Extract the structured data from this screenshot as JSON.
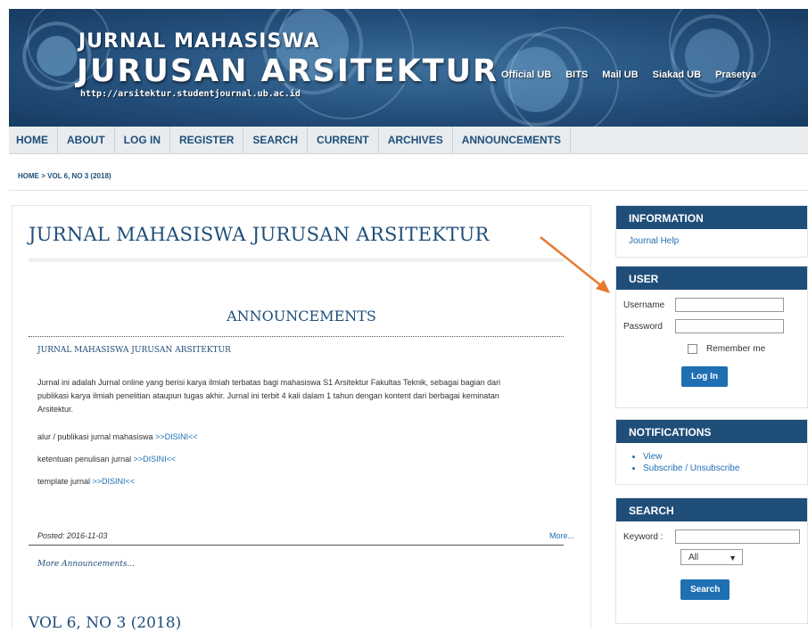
{
  "header": {
    "logo_line1": "JURNAL MAHASISWA",
    "logo_line2": "JURUSAN ARSITEKTUR",
    "logo_url": "http://arsitektur.studentjournal.ub.ac.id",
    "ext_links": [
      "Official UB",
      "BITS",
      "Mail UB",
      "Siakad UB",
      "Prasetya"
    ]
  },
  "nav": [
    "HOME",
    "ABOUT",
    "LOG IN",
    "REGISTER",
    "SEARCH",
    "CURRENT",
    "ARCHIVES",
    "ANNOUNCEMENTS"
  ],
  "breadcrumb": "HOME > VOL 6, NO 3 (2018)",
  "main": {
    "title": "JURNAL MAHASISWA JURUSAN ARSITEKTUR",
    "announcements_heading": "ANNOUNCEMENTS",
    "announcement_title": "JURNAL MAHASISWA JURUSAN ARSITEKTUR",
    "announcement_body": "Jurnal ini adalah Jurnal online yang berisi karya ilmiah terbatas bagi mahasiswa S1 Arsitektur Fakultas Teknik, sebagai bagian dari publikasi karya ilmiah penelitian ataupun tugas akhir. Jurnal ini terbit 4 kali dalam 1 tahun  dengan kontent dari berbagai keminatan Arsitektur.",
    "line1_text": "alur / publikasi jurnal mahasiswa ",
    "line1_link": ">>DISINI<<",
    "line2_text": "ketentuan penulisan jurnal ",
    "line2_link": ">>DISINI<<",
    "line3_text": "template jurnal ",
    "line3_link": ">>DISINI<<",
    "posted": "Posted: 2016-11-03",
    "more": "More...",
    "more_announcements": "More Announcements...",
    "issue_heading": "VOL 6, NO 3 (2018)"
  },
  "sidebar": {
    "information_title": "INFORMATION",
    "journal_help": "Journal Help",
    "user_title": "USER",
    "username_label": "Username",
    "password_label": "Password",
    "remember_me": "Remember me",
    "login_button": "Log In",
    "notifications_title": "NOTIFICATIONS",
    "notif_view": "View",
    "notif_subscribe": "Subscribe / Unsubscribe",
    "search_title": "SEARCH",
    "keyword_label": "Keyword :",
    "scope_selected": "All",
    "search_button": "Search"
  },
  "colors": {
    "brand_blue": "#1f4e79",
    "link_blue": "#1f6fb3",
    "arrow_orange": "#e8792f"
  }
}
